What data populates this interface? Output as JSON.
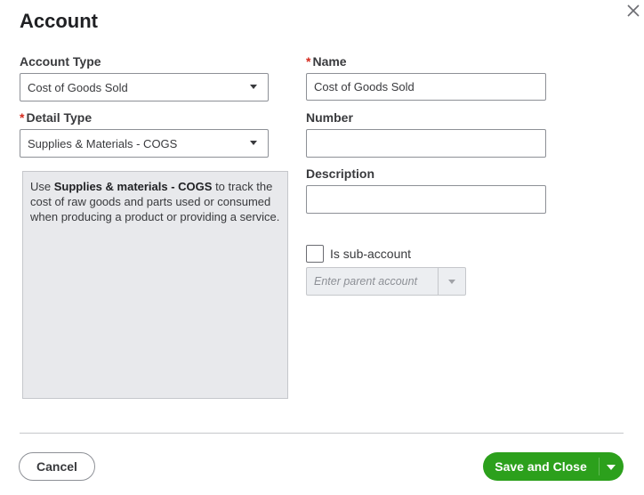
{
  "dialog": {
    "title": "Account",
    "close_icon": "close-icon"
  },
  "left": {
    "account_type_label": "Account Type",
    "account_type_value": "Cost of Goods Sold",
    "detail_type_required": "*",
    "detail_type_label": "Detail Type",
    "detail_type_value": "Supplies & Materials - COGS",
    "help_prefix": "Use ",
    "help_bold": "Supplies & materials - COGS",
    "help_suffix": " to track the cost of raw goods and parts used or consumed when producing a product or providing a service."
  },
  "right": {
    "name_required": "*",
    "name_label": "Name",
    "name_value": "Cost of Goods Sold",
    "number_label": "Number",
    "number_value": "",
    "description_label": "Description",
    "description_value": "",
    "subaccount_label": "Is sub-account",
    "subaccount_checked": false,
    "parent_placeholder": "Enter parent account"
  },
  "footer": {
    "cancel_label": "Cancel",
    "save_label": "Save and Close"
  },
  "colors": {
    "primary": "#2ca01c",
    "required": "#d52b1e"
  }
}
